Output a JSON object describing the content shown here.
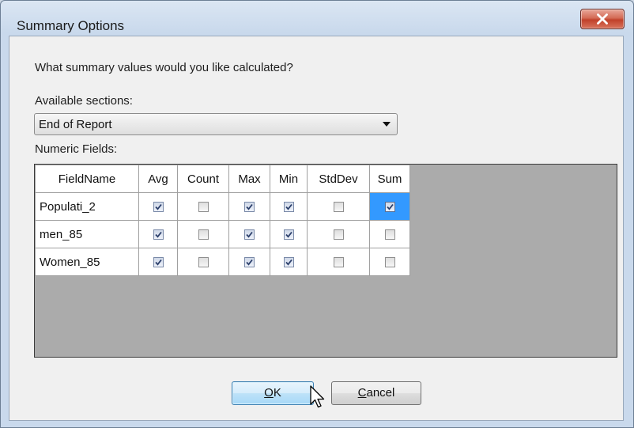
{
  "window": {
    "title": "Summary Options"
  },
  "prompt": "What summary values would you like calculated?",
  "sections": {
    "label": "Available sections:",
    "selected": "End of Report"
  },
  "numeric_fields": {
    "label": "Numeric Fields:",
    "columns": [
      "FieldName",
      "Avg",
      "Count",
      "Max",
      "Min",
      "StdDev",
      "Sum"
    ],
    "rows": [
      {
        "name": "Populati_2",
        "Avg": true,
        "Count": false,
        "Max": true,
        "Min": true,
        "StdDev": false,
        "Sum": true
      },
      {
        "name": "men_85",
        "Avg": true,
        "Count": false,
        "Max": true,
        "Min": true,
        "StdDev": false,
        "Sum": false
      },
      {
        "name": "Women_85",
        "Avg": true,
        "Count": false,
        "Max": true,
        "Min": true,
        "StdDev": false,
        "Sum": false
      }
    ],
    "selected_cell": {
      "row": 0,
      "column": "Sum"
    }
  },
  "buttons": {
    "ok": {
      "label": "OK",
      "mnemonic": "O"
    },
    "cancel": {
      "label": "Cancel",
      "mnemonic": "C"
    }
  },
  "colors": {
    "selection": "#3399ff",
    "close_button": "#c1412a"
  }
}
